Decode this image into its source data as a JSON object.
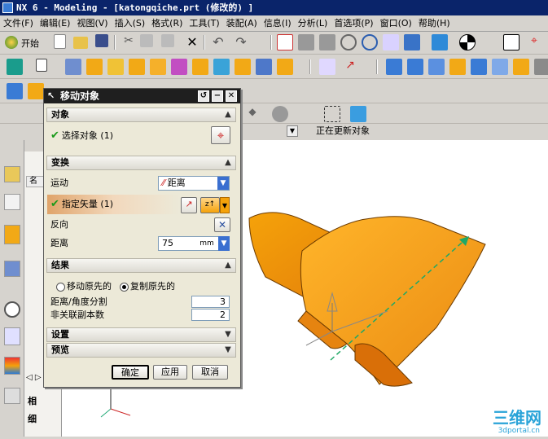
{
  "window": {
    "title": "NX 6 - Modeling - [katongqiche.prt (修改的) ]"
  },
  "menu": [
    "文件(F)",
    "编辑(E)",
    "视图(V)",
    "插入(S)",
    "格式(R)",
    "工具(T)",
    "装配(A)",
    "信息(I)",
    "分析(L)",
    "首选项(P)",
    "窗口(O)",
    "帮助(H)"
  ],
  "toolbar": {
    "start_label": "开始"
  },
  "status": {
    "text": "正在更新对象"
  },
  "nav": {
    "column_header": "名",
    "tab1": "相",
    "tab2": "细"
  },
  "dialog": {
    "title": "移动对象",
    "object_section": "对象",
    "select_object": "选择对象 (1)",
    "transform_section": "变换",
    "motion_label": "运动",
    "motion_value": "距离",
    "vector_label": "指定矢量 (1)",
    "reverse_label": "反向",
    "distance_label": "距离",
    "distance_value": "75",
    "distance_unit": "mm",
    "result_section": "结果",
    "move_original": "移动原先的",
    "copy_original": "复制原先的",
    "divisions_label": "距离/角度分割",
    "divisions_value": "3",
    "copies_label": "非关联副本数",
    "copies_value": "2",
    "settings_section": "设置",
    "preview_section": "预览",
    "ok_label": "确定",
    "apply_label": "应用",
    "cancel_label": "取消"
  },
  "watermark": {
    "brand": "三维网",
    "url": "3dportal.cn"
  },
  "colors": {
    "accent_orange": "#f5a20a",
    "dialog_title_bg": "#1f1f1f",
    "check_green": "#1a9a1a"
  }
}
